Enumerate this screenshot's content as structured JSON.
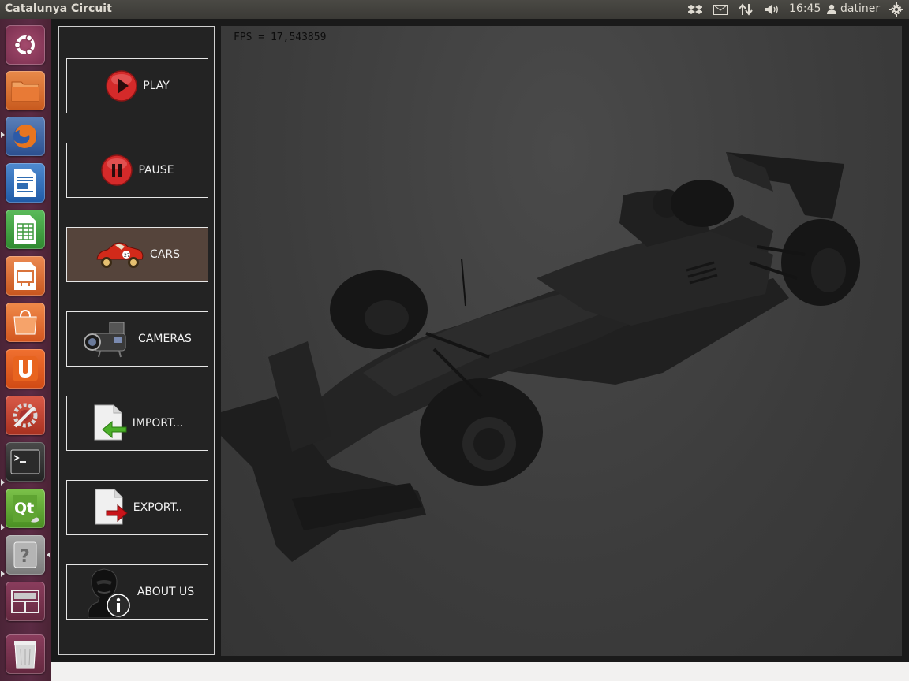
{
  "window": {
    "title": "Catalunya Circuit"
  },
  "indicators": {
    "clock": "16:45",
    "user": "datiner"
  },
  "launcher": {
    "items": [
      {
        "name": "ubuntu-dash",
        "bg": "#8a3b57"
      },
      {
        "name": "files",
        "bg": "#d96a2b"
      },
      {
        "name": "firefox",
        "bg": "#c34a2a"
      },
      {
        "name": "libreoffice-writer",
        "bg": "#2f6cb2"
      },
      {
        "name": "libreoffice-calc",
        "bg": "#3e9a3e"
      },
      {
        "name": "libreoffice-impress",
        "bg": "#d9733b"
      },
      {
        "name": "software-center",
        "bg": "#d9552b"
      },
      {
        "name": "ubuntu-one",
        "bg": "#dd5a1f"
      },
      {
        "name": "system-settings",
        "bg": "#c8402e"
      },
      {
        "name": "terminal",
        "bg": "#3a3a3a"
      },
      {
        "name": "qt-creator",
        "bg": "#5fa432"
      },
      {
        "name": "unknown-app",
        "bg": "#8e8e8e"
      },
      {
        "name": "workspace-switcher",
        "bg": "#7a3650"
      },
      {
        "name": "trash",
        "bg": "#7a3650"
      }
    ]
  },
  "menu": {
    "play": "PLAY",
    "pause": "PAUSE",
    "cars": "CARS",
    "cameras": "CAMERAS",
    "import": "IMPORT...",
    "export": "EXPORT..",
    "about": "ABOUT US"
  },
  "viewport": {
    "fps": "FPS = 17,543859"
  },
  "colors": {
    "accent_active": "#55443b",
    "panel_bg": "#232323",
    "launcher_bg": "#5b2b44"
  }
}
